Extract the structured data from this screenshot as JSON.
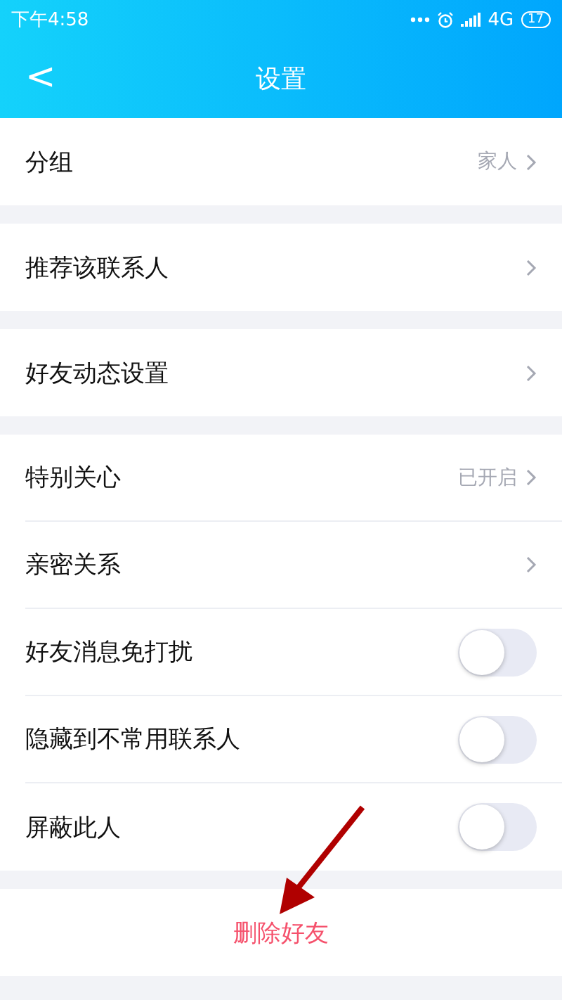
{
  "status_bar": {
    "time": "下午4:58",
    "network": "4G",
    "battery": "17"
  },
  "header": {
    "back": "<",
    "title": "设置"
  },
  "sections": [
    {
      "rows": [
        {
          "kind": "link",
          "label": "分组",
          "value": "家人"
        }
      ]
    },
    {
      "rows": [
        {
          "kind": "link",
          "label": "推荐该联系人"
        }
      ]
    },
    {
      "rows": [
        {
          "kind": "link",
          "label": "好友动态设置"
        }
      ]
    },
    {
      "rows": [
        {
          "kind": "link",
          "label": "特别关心",
          "value": "已开启"
        },
        {
          "kind": "link",
          "label": "亲密关系"
        },
        {
          "kind": "toggle",
          "label": "好友消息免打扰",
          "on": false
        },
        {
          "kind": "toggle",
          "label": "隐藏到不常用联系人",
          "on": false
        },
        {
          "kind": "toggle",
          "label": "屏蔽此人",
          "on": false
        }
      ]
    }
  ],
  "delete_button": "删除好友"
}
